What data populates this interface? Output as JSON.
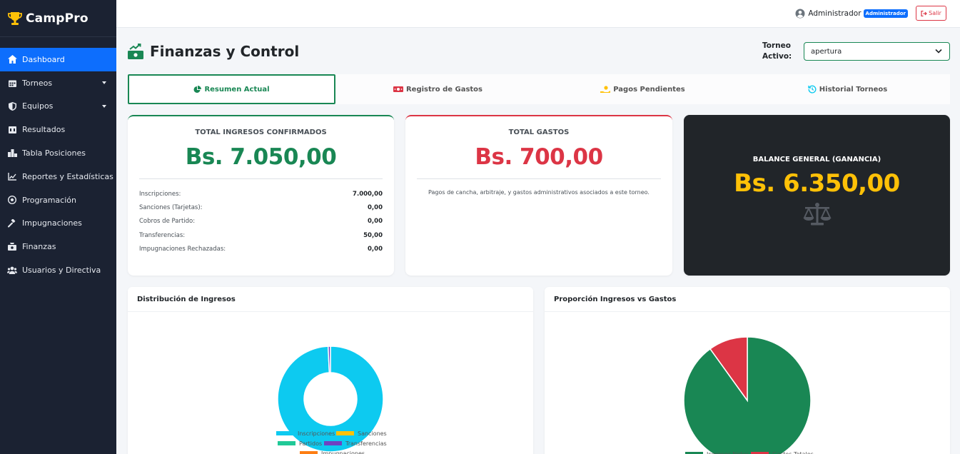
{
  "app": {
    "name": "CampPro"
  },
  "sidebar": {
    "items": [
      {
        "label": "Dashboard",
        "icon": "home-icon",
        "active": true
      },
      {
        "label": "Torneos",
        "icon": "calendar-icon",
        "caret": true
      },
      {
        "label": "Equipos",
        "icon": "shield-icon",
        "caret": true
      },
      {
        "label": "Resultados",
        "icon": "scoreboard-icon"
      },
      {
        "label": "Tabla Posiciones",
        "icon": "podium-icon"
      },
      {
        "label": "Reportes y Estadísticas",
        "icon": "line-chart-icon"
      },
      {
        "label": "Programación",
        "icon": "soccer-ball-icon"
      },
      {
        "label": "Impugnaciones",
        "icon": "gavel-icon"
      },
      {
        "label": "Finanzas",
        "icon": "money-icon"
      },
      {
        "label": "Usuarios y Directiva",
        "icon": "users-icon"
      }
    ]
  },
  "topbar": {
    "user_name": "Administrador",
    "role": "Administrador",
    "logout_label": "Salir"
  },
  "header": {
    "title": "Finanzas y Control",
    "torneo_label": "Torneo Activo:",
    "torneo_selected": "apertura"
  },
  "tabs": [
    {
      "label": "Resumen Actual",
      "icon": "pie-icon",
      "active": true
    },
    {
      "label": "Registro de Gastos",
      "icon": "money-bill-icon"
    },
    {
      "label": "Pagos Pendientes",
      "icon": "hand-coin-icon"
    },
    {
      "label": "Historial Torneos",
      "icon": "history-icon"
    }
  ],
  "summary": {
    "ingresos": {
      "heading": "TOTAL INGRESOS CONFIRMADOS",
      "amount": "Bs. 7.050,00",
      "breakdown": [
        {
          "label": "Inscripciones:",
          "value": "7.000,00"
        },
        {
          "label": "Sanciones (Tarjetas):",
          "value": "0,00"
        },
        {
          "label": "Cobros de Partido:",
          "value": "0,00"
        },
        {
          "label": "Transferencias:",
          "value": "50,00"
        },
        {
          "label": "Impugnaciones Rechazadas:",
          "value": "0,00"
        }
      ]
    },
    "gastos": {
      "heading": "TOTAL GASTOS",
      "amount": "Bs. 700,00",
      "note": "Pagos de cancha, arbitraje, y gastos administrativos asociados a este torneo."
    },
    "balance": {
      "heading": "BALANCE GENERAL (GANANCIA)",
      "amount": "Bs. 6.350,00"
    }
  },
  "panels": {
    "left_title": "Distribución de Ingresos",
    "right_title": "Proporción Ingresos vs Gastos"
  },
  "colors": {
    "primary": "#0d6efd",
    "success": "#198754",
    "danger": "#dc3545",
    "warning": "#ffc107",
    "sidebar": "#1b2232"
  },
  "chart_data": [
    {
      "type": "pie",
      "variant": "doughnut",
      "title": "Distribución de Ingresos",
      "categories": [
        "Inscripciones",
        "Sanciones",
        "Partidos",
        "Transferencias",
        "Impugnaciones"
      ],
      "values": [
        7000,
        0,
        0,
        50,
        0
      ],
      "colors": [
        "#0dcaf0",
        "#ffc107",
        "#20c997",
        "#6f42c1",
        "#fd7e14"
      ],
      "legend": "bottom"
    },
    {
      "type": "pie",
      "title": "Proporción Ingresos vs Gastos",
      "categories": [
        "Ingresos Netos",
        "Gastos Totales"
      ],
      "values": [
        6350,
        700
      ],
      "colors": [
        "#198754",
        "#dc3545"
      ],
      "legend": "bottom"
    }
  ]
}
